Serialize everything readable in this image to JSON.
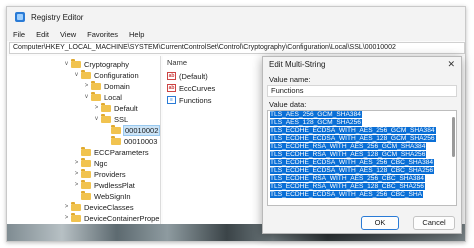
{
  "window": {
    "title": "Registry Editor"
  },
  "menu": [
    "File",
    "Edit",
    "View",
    "Favorites",
    "Help"
  ],
  "address": "Computer\\HKEY_LOCAL_MACHINE\\SYSTEM\\CurrentControlSet\\Control\\Cryptography\\Configuration\\Local\\SSL\\00010002",
  "tree": [
    {
      "label": "Cryptography",
      "chevron": "v"
    },
    {
      "label": "Configuration",
      "chevron": "v"
    },
    {
      "label": "Domain",
      "chevron": ">"
    },
    {
      "label": "Local",
      "chevron": "v"
    },
    {
      "label": "Default",
      "chevron": ">"
    },
    {
      "label": "SSL",
      "chevron": "v"
    },
    {
      "label": "00010002",
      "chevron": ""
    },
    {
      "label": "00010003",
      "chevron": ""
    },
    {
      "label": "ECCParameters",
      "chevron": ""
    },
    {
      "label": "Ngc",
      "chevron": ">"
    },
    {
      "label": "Providers",
      "chevron": ">"
    },
    {
      "label": "PwdlessPlat",
      "chevron": ">"
    },
    {
      "label": "WebSignIn",
      "chevron": ""
    },
    {
      "label": "DeviceClasses",
      "chevron": ">"
    },
    {
      "label": "DeviceContainerPrope",
      "chevron": ">"
    }
  ],
  "values_header": "Name",
  "values": [
    {
      "name": "(Default)",
      "icon": "ab"
    },
    {
      "name": "EccCurves",
      "icon": "ab"
    },
    {
      "name": "Functions",
      "icon": "binary"
    }
  ],
  "dialog": {
    "title": "Edit Multi-String",
    "close": "✕",
    "value_name_label": "Value name:",
    "value_name": "Functions",
    "value_data_label": "Value data:",
    "lines": [
      "TLS_AES_256_GCM_SHA384",
      "TLS_AES_128_GCM_SHA256",
      "TLS_ECDHE_ECDSA_WITH_AES_256_GCM_SHA384",
      "TLS_ECDHE_ECDSA_WITH_AES_128_GCM_SHA256",
      "TLS_ECDHE_RSA_WITH_AES_256_GCM_SHA384",
      "TLS_ECDHE_RSA_WITH_AES_128_GCM_SHA256",
      "TLS_ECDHE_ECDSA_WITH_AES_256_CBC_SHA384",
      "TLS_ECDHE_ECDSA_WITH_AES_128_CBC_SHA256",
      "TLS_ECDHE_RSA_WITH_AES_256_CBC_SHA384",
      "TLS_ECDHE_RSA_WITH_AES_128_CBC_SHA256",
      "TLS_ECDHE_ECDSA_WITH_AES_256_CBC_SHA"
    ],
    "ok": "OK",
    "cancel": "Cancel"
  }
}
